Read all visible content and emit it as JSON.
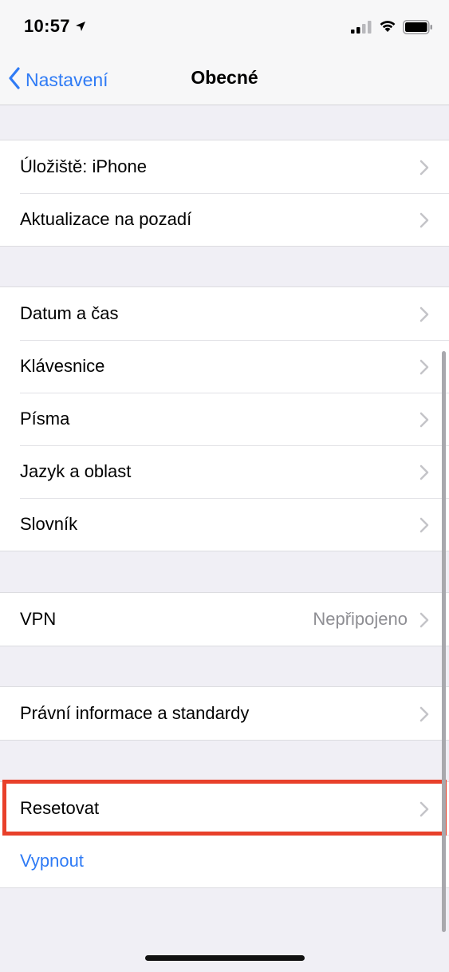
{
  "status_bar": {
    "time": "10:57",
    "icons": [
      "location-arrow-icon",
      "cellular-signal-icon",
      "wifi-icon",
      "battery-icon"
    ]
  },
  "nav": {
    "back_label": "Nastavení",
    "title": "Obecné"
  },
  "groups": {
    "storage": [
      {
        "label": "Úložiště: iPhone"
      },
      {
        "label": "Aktualizace na pozadí"
      }
    ],
    "locale": [
      {
        "label": "Datum a čas"
      },
      {
        "label": "Klávesnice"
      },
      {
        "label": "Písma"
      },
      {
        "label": "Jazyk a oblast"
      },
      {
        "label": "Slovník"
      }
    ],
    "vpn": [
      {
        "label": "VPN",
        "value": "Nepřipojeno"
      }
    ],
    "legal": [
      {
        "label": "Právní informace a standardy"
      }
    ],
    "reset": [
      {
        "label": "Resetovat"
      },
      {
        "label": "Vypnout"
      }
    ]
  },
  "colors": {
    "accent": "#2f7bf5",
    "highlight": "#e8402a",
    "background": "#f0eff5"
  }
}
